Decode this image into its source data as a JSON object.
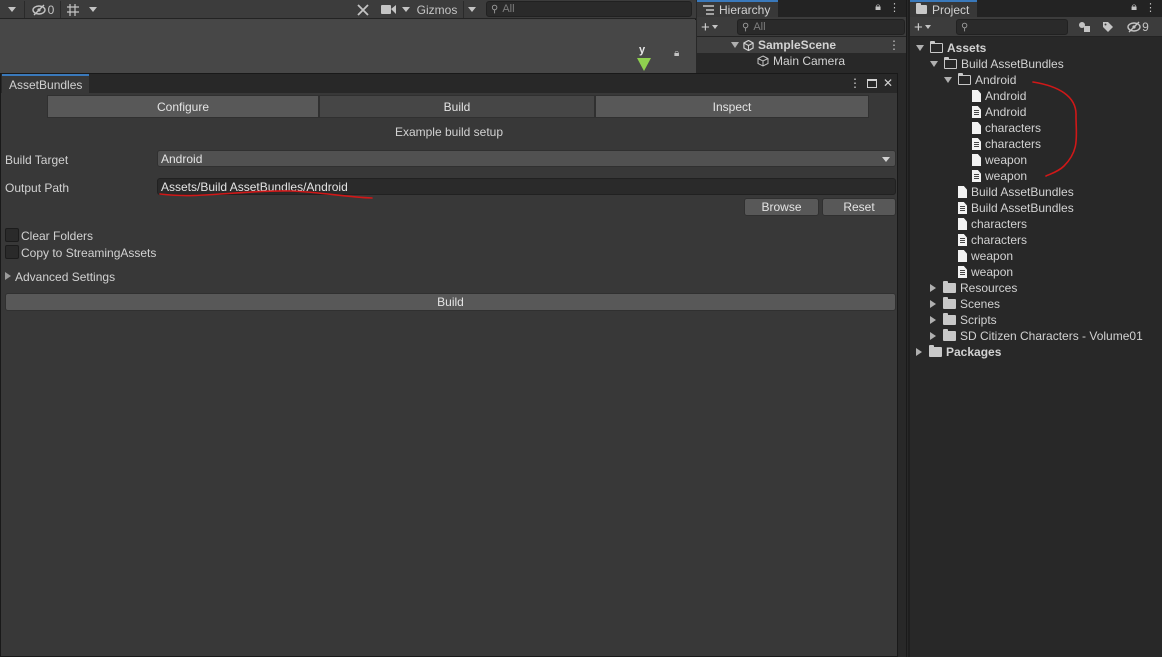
{
  "scene": {
    "toolbar": {
      "hidden_count": "0",
      "gizmos_label": "Gizmos",
      "search_placeholder": "All"
    },
    "gizmo_axis_label": "y"
  },
  "hierarchy": {
    "tab_label": "Hierarchy",
    "search_placeholder": "All",
    "scene_name": "SampleScene",
    "items": [
      {
        "label": "Main Camera"
      }
    ]
  },
  "project": {
    "tab_label": "Project",
    "hidden_count": "9",
    "tree": [
      {
        "label": "Assets"
      },
      {
        "label": "Build AssetBundles"
      },
      {
        "label": "Android"
      },
      {
        "label": "Android"
      },
      {
        "label": "Android"
      },
      {
        "label": "characters"
      },
      {
        "label": "characters"
      },
      {
        "label": "weapon"
      },
      {
        "label": "weapon"
      },
      {
        "label": "Build AssetBundles"
      },
      {
        "label": "Build AssetBundles"
      },
      {
        "label": "characters"
      },
      {
        "label": "characters"
      },
      {
        "label": "weapon"
      },
      {
        "label": "weapon"
      },
      {
        "label": "Resources"
      },
      {
        "label": "Scenes"
      },
      {
        "label": "Scripts"
      },
      {
        "label": "SD Citizen Characters - Volume01"
      },
      {
        "label": "Packages"
      }
    ]
  },
  "asset_bundles": {
    "window_title": "AssetBundles",
    "tabs": [
      {
        "label": "Configure"
      },
      {
        "label": "Build"
      },
      {
        "label": "Inspect"
      }
    ],
    "active_tab": "Build",
    "heading": "Example build setup",
    "build_target": {
      "label": "Build Target",
      "value": "Android"
    },
    "output_path": {
      "label": "Output Path",
      "value": "Assets/Build AssetBundles/Android"
    },
    "browse_label": "Browse",
    "reset_label": "Reset",
    "clear_folders_label": "Clear Folders",
    "copy_streaming_label": "Copy to StreamingAssets",
    "advanced_settings_label": "Advanced Settings",
    "build_button_label": "Build"
  },
  "colors": {
    "accent_tab": "#3a79bb",
    "annotation_red": "#d01818",
    "gizmo_y": "#8fd14f"
  }
}
